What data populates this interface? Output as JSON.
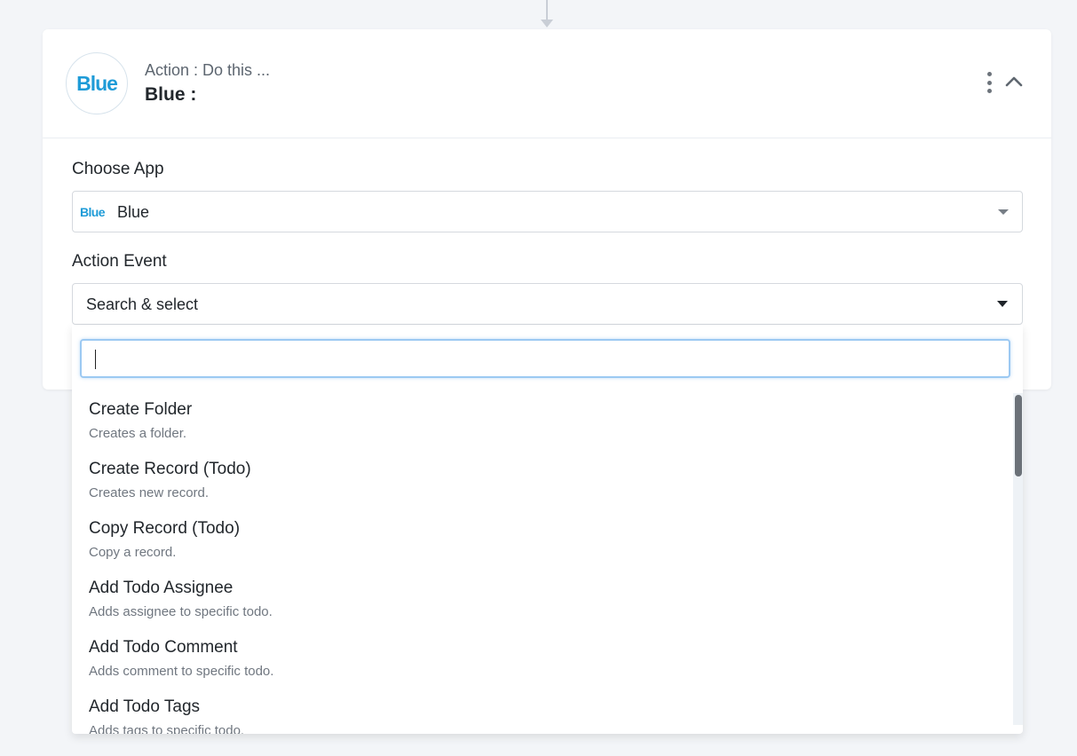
{
  "header": {
    "step_label": "Action : Do this ...",
    "step_title": "Blue :",
    "logo_text": "Blue"
  },
  "choose_app": {
    "label": "Choose App",
    "logo_text": "Blue",
    "value": "Blue"
  },
  "action_event": {
    "label": "Action Event",
    "placeholder": "Search & select"
  },
  "dropdown": {
    "search_value": "",
    "options": [
      {
        "title": "Create Folder",
        "desc": "Creates a folder."
      },
      {
        "title": "Create Record (Todo)",
        "desc": "Creates new record."
      },
      {
        "title": "Copy Record (Todo)",
        "desc": "Copy a record."
      },
      {
        "title": "Add Todo Assignee",
        "desc": "Adds assignee to specific todo."
      },
      {
        "title": "Add Todo Comment",
        "desc": "Adds comment to specific todo."
      },
      {
        "title": "Add Todo Tags",
        "desc": "Adds tags to specific todo."
      }
    ]
  },
  "colors": {
    "brand": "#1e9bd7",
    "focus_border": "#9cc9f2",
    "background": "#f3f5f8"
  },
  "icons": [
    "kebab-menu-icon",
    "chevron-up-icon",
    "caret-down-icon"
  ]
}
